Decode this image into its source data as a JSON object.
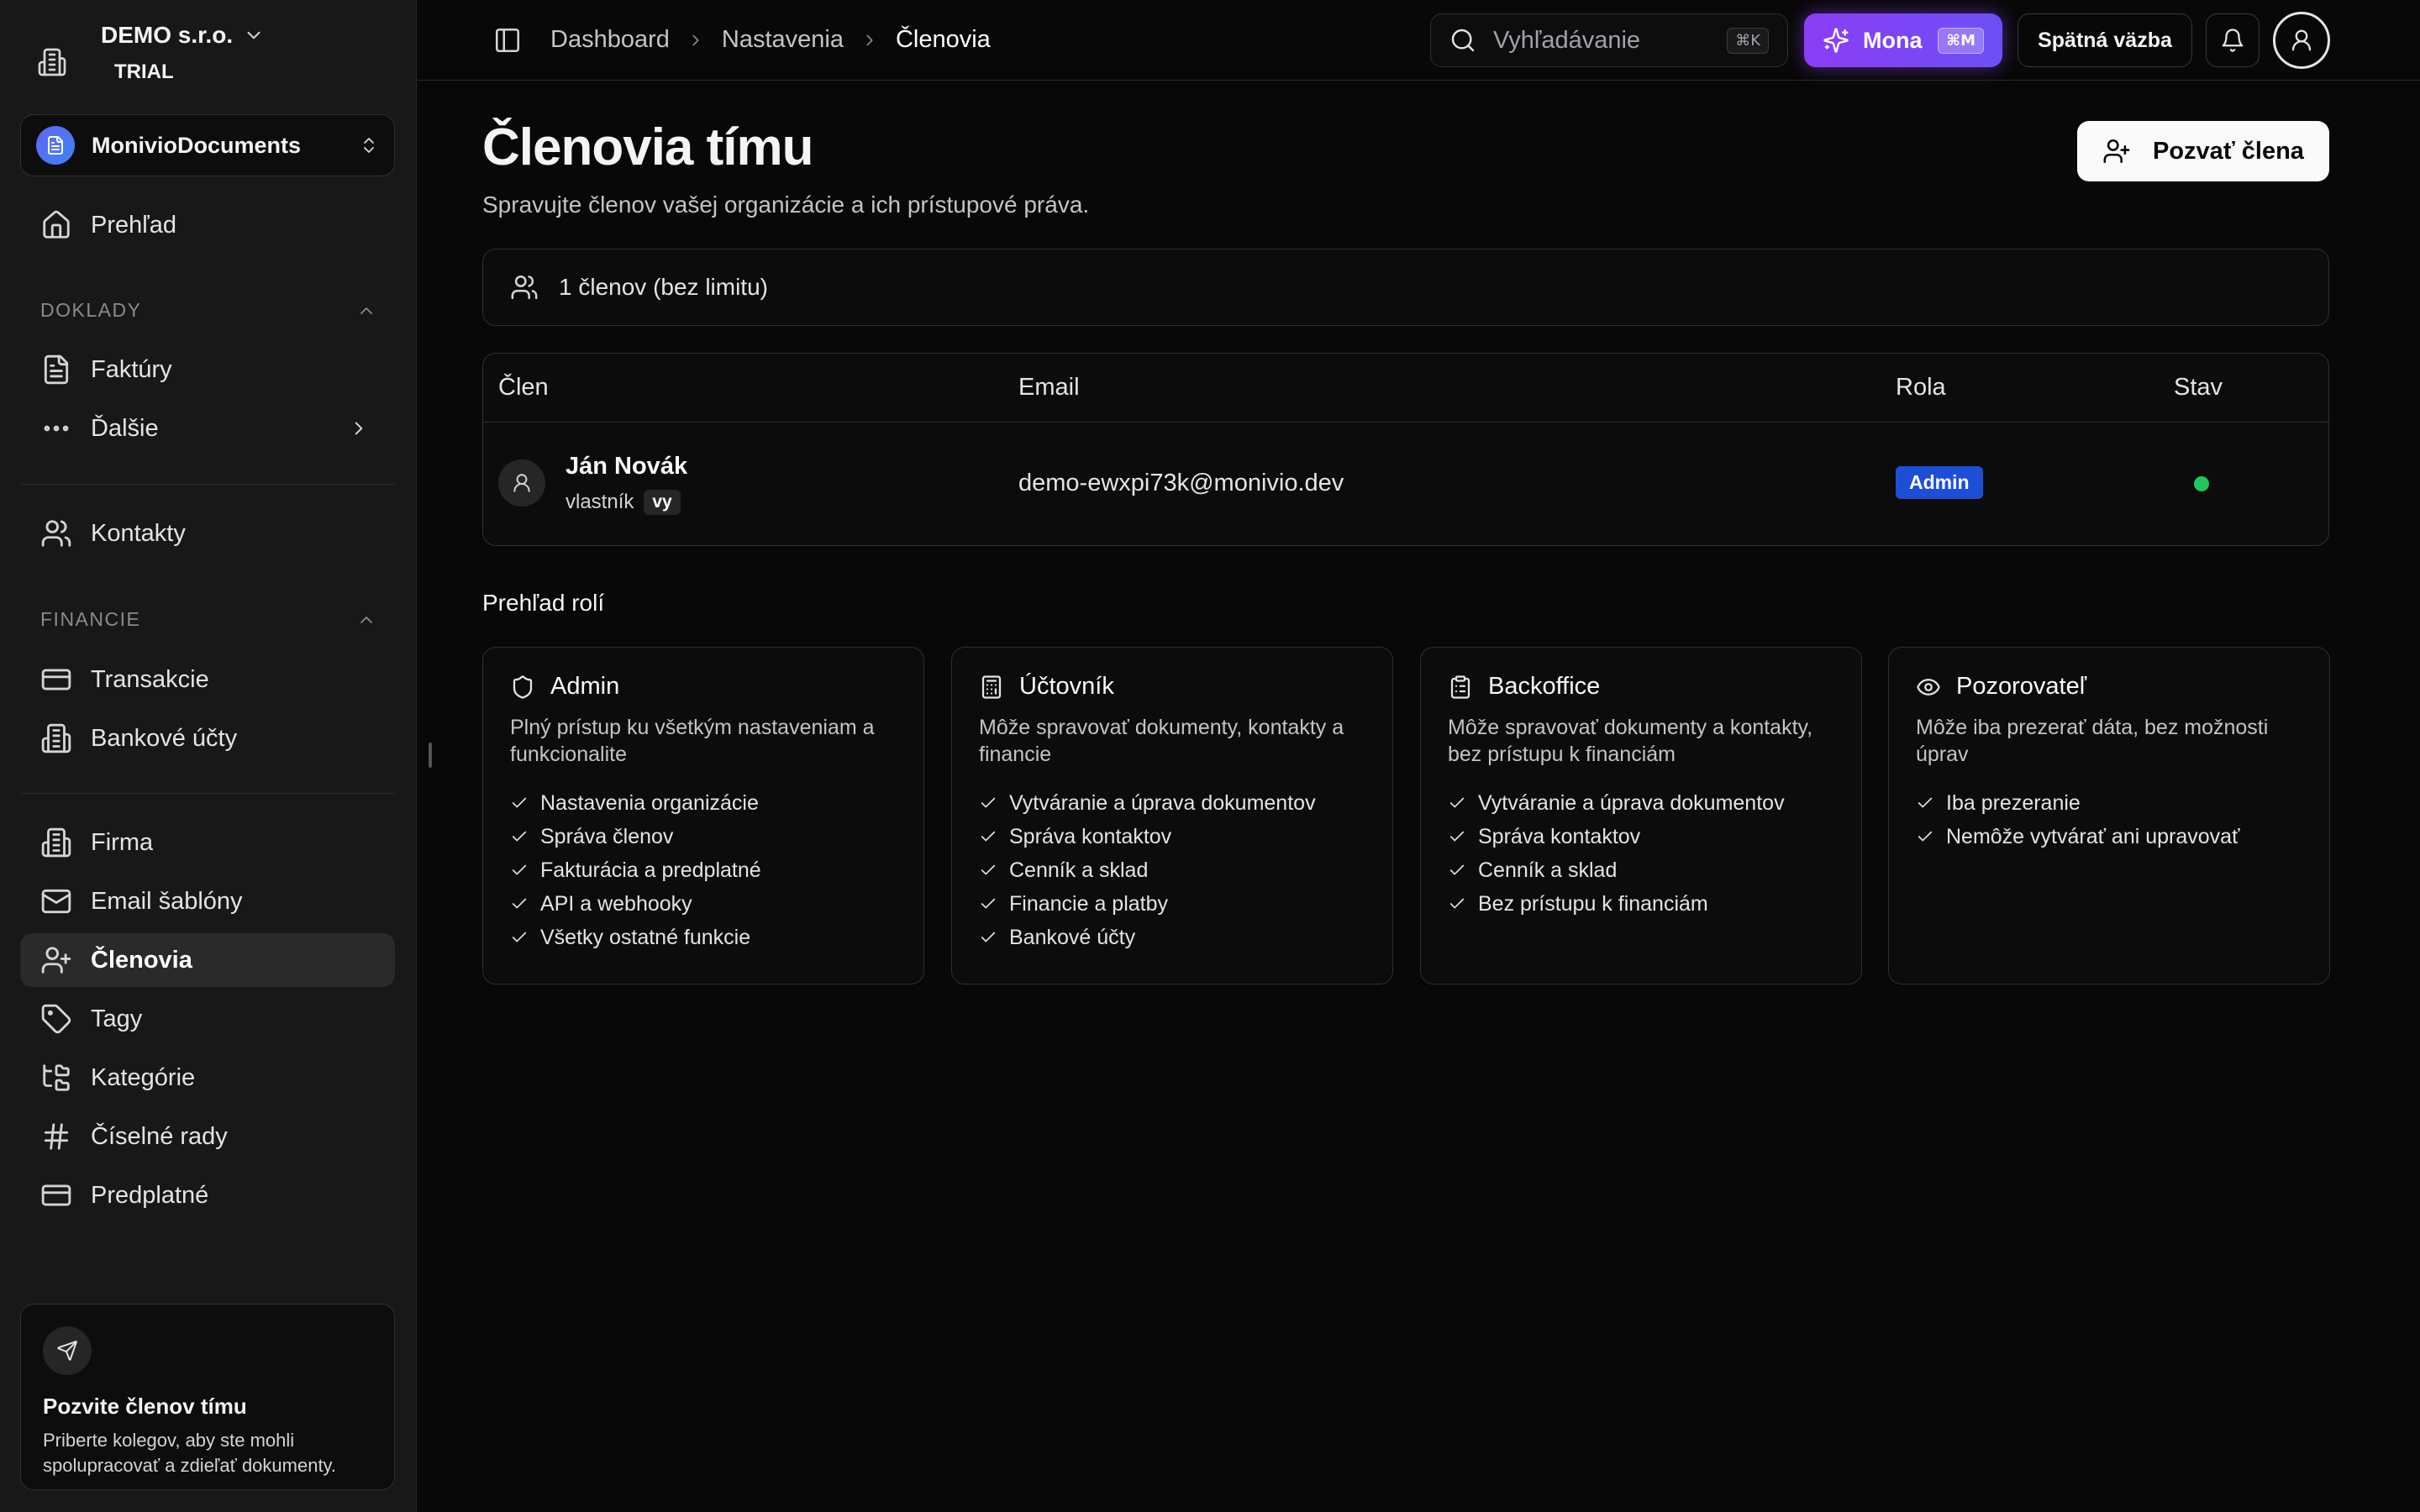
{
  "org": {
    "name": "DEMO s.r.o.",
    "plan": "TRIAL"
  },
  "app_switcher": {
    "name": "MonivioDocuments"
  },
  "sidebar": {
    "overview": "Prehľad",
    "section_doklady": "DOKLADY",
    "invoices": "Faktúry",
    "more": "Ďalšie",
    "contacts": "Kontakty",
    "section_financie": "FINANCIE",
    "transactions": "Transakcie",
    "bank_accounts": "Bankové účty",
    "company": "Firma",
    "email_templates": "Email šablóny",
    "members": "Členovia",
    "tags": "Tagy",
    "categories": "Kategórie",
    "number_series": "Číselné rady",
    "subscription": "Predplatné"
  },
  "invite_card": {
    "title": "Pozvite členov tímu",
    "description": "Priberte kolegov, aby ste mohli spolupracovať a zdieľať dokumenty."
  },
  "header": {
    "breadcrumb": [
      "Dashboard",
      "Nastavenia",
      "Členovia"
    ],
    "search_placeholder": "Vyhľadávanie",
    "search_shortcut": "⌘K",
    "mona_label": "Mona",
    "mona_shortcut": "⌘M",
    "feedback_label": "Spätná väzba"
  },
  "page": {
    "title": "Členovia tímu",
    "subtitle": "Spravujte členov vašej organizácie a ich prístupové práva.",
    "invite_button": "Pozvať člena",
    "member_count": "1 členov (bez limitu)"
  },
  "table": {
    "headers": [
      "Člen",
      "Email",
      "Rola",
      "Stav"
    ],
    "rows": [
      {
        "name": "Ján Novák",
        "role_label": "vlastník",
        "you_badge": "vy",
        "email": "demo-ewxpi73k@monivio.dev",
        "role": "Admin",
        "status_color": "#22c55e"
      }
    ]
  },
  "roles": {
    "title": "Prehľad rolí",
    "cards": [
      {
        "icon": "shield-icon",
        "name": "Admin",
        "description": "Plný prístup ku všetkým nastaveniam a funkcionalite",
        "items": [
          "Nastavenia organizácie",
          "Správa členov",
          "Fakturácia a predplatné",
          "API a webhooky",
          "Všetky ostatné funkcie"
        ]
      },
      {
        "icon": "calculator-icon",
        "name": "Účtovník",
        "description": "Môže spravovať dokumenty, kontakty a financie",
        "items": [
          "Vytváranie a úprava dokumentov",
          "Správa kontaktov",
          "Cenník a sklad",
          "Financie a platby",
          "Bankové účty"
        ]
      },
      {
        "icon": "clipboard-icon",
        "name": "Backoffice",
        "description": "Môže spravovať dokumenty a kontakty, bez prístupu k financiám",
        "items": [
          "Vytváranie a úprava dokumentov",
          "Správa kontaktov",
          "Cenník a sklad",
          "Bez prístupu k financiám"
        ]
      },
      {
        "icon": "eye-icon",
        "name": "Pozorovateľ",
        "description": "Môže iba prezerať dáta, bez možnosti úprav",
        "items": [
          "Iba prezeranie",
          "Nemôže vytvárať ani upravovať"
        ]
      }
    ]
  },
  "colors": {
    "accent_mona": "#8b3df5",
    "admin_badge": "#1d4ed8",
    "status_active": "#22c55e",
    "background": "#080808",
    "sidebar": "#181818"
  }
}
